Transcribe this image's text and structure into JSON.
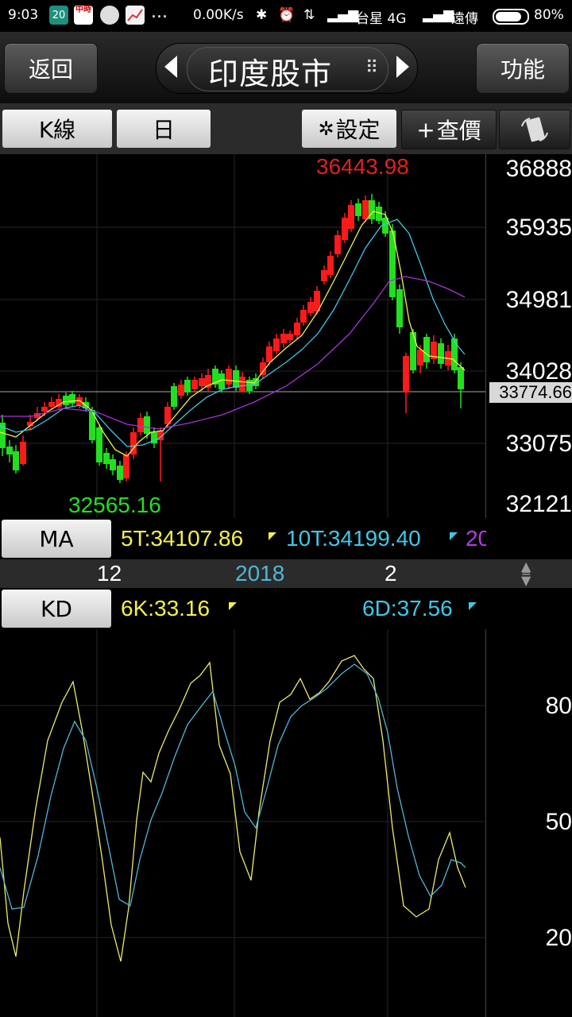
{
  "status_bar": {
    "time": "9:03",
    "notif_badge": "20",
    "app_icon_label": "中時",
    "more": "...",
    "net_speed": "0.00K/s",
    "carrier1": "台星 4G",
    "carrier2": "遠傳",
    "battery": "80%"
  },
  "header": {
    "back_label": "返回",
    "title": "印度股市",
    "function_label": "功能"
  },
  "toolbar": {
    "kline_label": "K線",
    "period_label": "日",
    "settings_label": "設定",
    "quote_label": "查價"
  },
  "main_chart": {
    "y_labels": [
      "36888",
      "35935",
      "34981",
      "34028",
      "33075",
      "32121"
    ],
    "high_label": "36443.98",
    "low_label": "32565.16",
    "current_price_label": "33774.66",
    "colors": {
      "up": "#ff1a1a",
      "down": "#22e01f",
      "ma5": "#f4f04a",
      "ma10": "#3fc8e8",
      "ma20": "#a833d8",
      "grid": "#262626"
    }
  },
  "ma_bar": {
    "button_label": "MA",
    "ma5": "5T:34107.86",
    "ma10": "10T:34199.40",
    "ma20": "20"
  },
  "x_axis": {
    "labels": [
      "12",
      "2018",
      "2"
    ]
  },
  "kd_bar": {
    "button_label": "KD",
    "k_value": "6K:33.16",
    "d_value": "6D:37.56"
  },
  "kd_chart": {
    "y_labels": [
      "80",
      "50",
      "20"
    ],
    "colors": {
      "k": "#ecec6a",
      "d": "#4fb7d8"
    }
  }
}
